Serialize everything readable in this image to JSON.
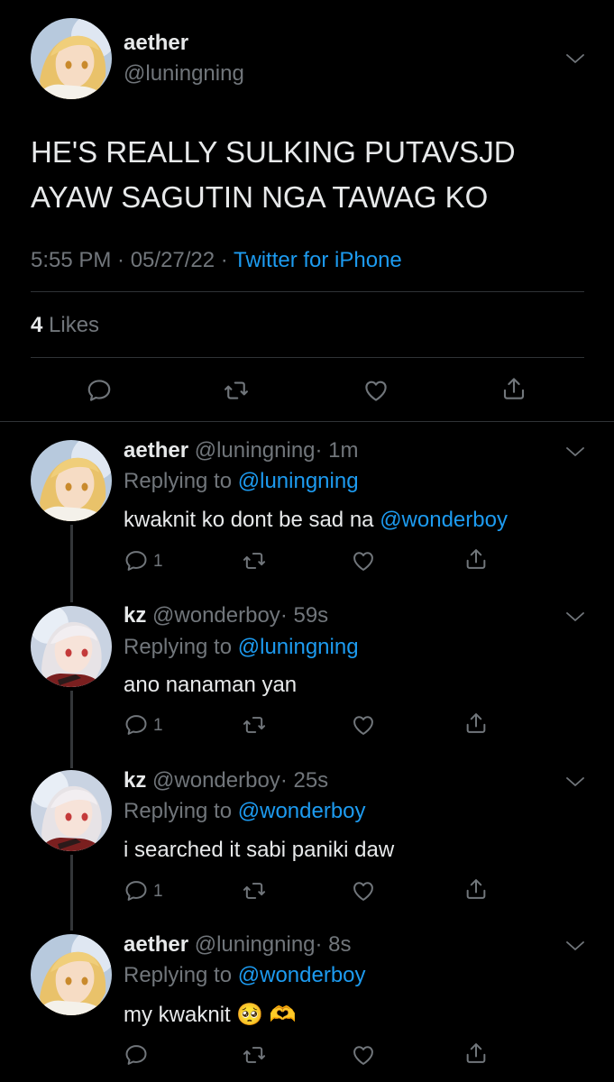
{
  "main_tweet": {
    "author_name": "aether",
    "author_handle": "@luningning",
    "text_line1": "HE'S REALLY SULKING PUTAVSJD",
    "text_line2": "AYAW SAGUTIN NGA TAWAG KO",
    "time_date": "5:55 PM · 05/27/22 · ",
    "source": "Twitter for iPhone",
    "likes_count": "4",
    "likes_label": "Likes"
  },
  "replies": [
    {
      "name": "aether",
      "handle": "@luningning",
      "time": "· 1m",
      "replying_prefix": "Replying to ",
      "replying_to": "@luningning",
      "text": "kwaknit ko dont be sad na ",
      "mention": "@wonderboy",
      "reply_count": "1",
      "avatar": "blonde-avatar"
    },
    {
      "name": "kz",
      "handle": "@wonderboy",
      "time": "· 59s",
      "replying_prefix": "Replying to ",
      "replying_to": "@luningning",
      "text": "ano nanaman yan",
      "reply_count": "1",
      "avatar": "white-hair-avatar"
    },
    {
      "name": "kz",
      "handle": "@wonderboy",
      "time": "· 25s",
      "replying_prefix": "Replying to ",
      "replying_to": "@wonderboy",
      "text": "i searched it sabi paniki daw",
      "reply_count": "1",
      "avatar": "white-hair-avatar"
    },
    {
      "name": "aether",
      "handle": "@luningning",
      "time": "· 8s",
      "replying_prefix": "Replying to ",
      "replying_to": "@wonderboy",
      "text": "my kwaknit ",
      "emoji": "🥺 🫶",
      "reply_count": "",
      "avatar": "blonde-avatar"
    }
  ],
  "colors": {
    "background": "#000000",
    "text": "#e7e9ea",
    "muted": "#71767b",
    "link": "#1d9bf0",
    "divider": "#2f3336"
  },
  "icons": {
    "reply": "reply-icon",
    "retweet": "retweet-icon",
    "like": "heart-icon",
    "share": "share-icon",
    "more": "chevron-down-icon"
  }
}
